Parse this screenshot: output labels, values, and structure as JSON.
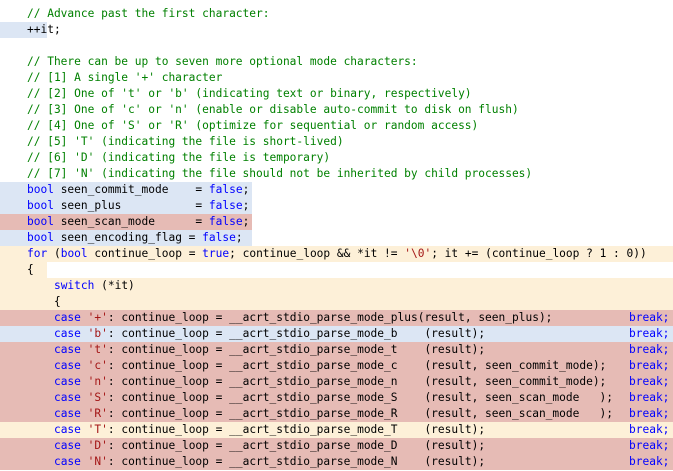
{
  "colors": {
    "default": "#000000",
    "comment": "#008000",
    "keyword": "#0000ff",
    "string": "#a31515",
    "highlight_blue": "#dce6f4",
    "highlight_red": "#e6bbb5",
    "highlight_yellow": "#fdf0d8"
  },
  "lines": [
    {
      "row": 0,
      "hl": null,
      "segs": [
        {
          "t": "// Advance past the first character:",
          "c": "comment"
        }
      ]
    },
    {
      "row": 1,
      "hl": "highlight_blue",
      "hlw": 47,
      "segs": [
        {
          "t": "++it;",
          "c": "default"
        }
      ]
    },
    {
      "row": 2,
      "hl": null,
      "segs": []
    },
    {
      "row": 3,
      "hl": null,
      "segs": [
        {
          "t": "// There can be up to seven more optional mode characters:",
          "c": "comment"
        }
      ]
    },
    {
      "row": 4,
      "hl": null,
      "segs": [
        {
          "t": "// [1] A single '+' character",
          "c": "comment"
        }
      ]
    },
    {
      "row": 5,
      "hl": null,
      "segs": [
        {
          "t": "// [2] One of 't' or 'b' (indicating text or binary, respectively)",
          "c": "comment"
        }
      ]
    },
    {
      "row": 6,
      "hl": null,
      "segs": [
        {
          "t": "// [3] One of 'c' or 'n' (enable or disable auto-commit to disk on flush)",
          "c": "comment"
        }
      ]
    },
    {
      "row": 7,
      "hl": null,
      "segs": [
        {
          "t": "// [4] One of 'S' or 'R' (optimize for sequential or random access)",
          "c": "comment"
        }
      ]
    },
    {
      "row": 8,
      "hl": null,
      "segs": [
        {
          "t": "// [5] 'T' (indicating the file is short-lived)",
          "c": "comment"
        }
      ]
    },
    {
      "row": 9,
      "hl": null,
      "segs": [
        {
          "t": "// [6] 'D' (indicating the file is temporary)",
          "c": "comment"
        }
      ]
    },
    {
      "row": 10,
      "hl": null,
      "segs": [
        {
          "t": "// [7] 'N' (indicating the file should not be inherited by child processes)",
          "c": "comment"
        }
      ]
    },
    {
      "row": 11,
      "hl": "highlight_blue",
      "hlw": 252,
      "segs": [
        {
          "t": "bool",
          "c": "keyword"
        },
        {
          "t": " seen_commit_mode    = ",
          "c": "default"
        },
        {
          "t": "false",
          "c": "keyword"
        },
        {
          "t": ";",
          "c": "default"
        }
      ]
    },
    {
      "row": 12,
      "hl": "highlight_blue",
      "hlw": 252,
      "segs": [
        {
          "t": "bool",
          "c": "keyword"
        },
        {
          "t": " seen_plus           = ",
          "c": "default"
        },
        {
          "t": "false",
          "c": "keyword"
        },
        {
          "t": ";",
          "c": "default"
        }
      ]
    },
    {
      "row": 13,
      "hl": "highlight_red",
      "hlw": 252,
      "segs": [
        {
          "t": "bool",
          "c": "keyword"
        },
        {
          "t": " seen_scan_mode      = ",
          "c": "default"
        },
        {
          "t": "false",
          "c": "keyword"
        },
        {
          "t": ";",
          "c": "default"
        }
      ]
    },
    {
      "row": 14,
      "hl": "highlight_blue",
      "hlw": 252,
      "segs": [
        {
          "t": "bool",
          "c": "keyword"
        },
        {
          "t": " seen_encoding_flag = ",
          "c": "default"
        },
        {
          "t": "false",
          "c": "keyword"
        },
        {
          "t": ";",
          "c": "default"
        }
      ]
    },
    {
      "row": 15,
      "hl": "highlight_yellow",
      "hlw": 673,
      "segs": [
        {
          "t": "for",
          "c": "keyword"
        },
        {
          "t": " (",
          "c": "default"
        },
        {
          "t": "bool",
          "c": "keyword"
        },
        {
          "t": " continue_loop = ",
          "c": "default"
        },
        {
          "t": "true",
          "c": "keyword"
        },
        {
          "t": "; continue_loop && *it != ",
          "c": "default"
        },
        {
          "t": "'\\0'",
          "c": "string"
        },
        {
          "t": "; it += (continue_loop ? 1 : 0))",
          "c": "default"
        }
      ]
    },
    {
      "row": 16,
      "hl": "highlight_yellow",
      "hlw": 47,
      "segs": [
        {
          "t": "{",
          "c": "default"
        }
      ]
    },
    {
      "row": 17,
      "hl": "highlight_yellow",
      "hlw": 673,
      "segs": [
        {
          "t": "    ",
          "c": "default"
        },
        {
          "t": "switch",
          "c": "keyword"
        },
        {
          "t": " (*it)",
          "c": "default"
        }
      ]
    },
    {
      "row": 18,
      "hl": "highlight_yellow",
      "hlw": 673,
      "segs": [
        {
          "t": "    {",
          "c": "default"
        }
      ]
    },
    {
      "row": 19,
      "hl": "highlight_red",
      "hlw": 673,
      "case": true,
      "segs": [
        {
          "t": "    ",
          "c": "default"
        },
        {
          "t": "case",
          "c": "keyword"
        },
        {
          "t": " ",
          "c": "default"
        },
        {
          "t": "'+'",
          "c": "string"
        },
        {
          "t": ": continue_loop = __acrt_stdio_parse_mode_plus(result, seen_plus);",
          "c": "default"
        }
      ]
    },
    {
      "row": 20,
      "hl": "highlight_blue",
      "hlw": 673,
      "case": true,
      "segs": [
        {
          "t": "    ",
          "c": "default"
        },
        {
          "t": "case",
          "c": "keyword"
        },
        {
          "t": " ",
          "c": "default"
        },
        {
          "t": "'b'",
          "c": "string"
        },
        {
          "t": ": continue_loop = __acrt_stdio_parse_mode_b    (result);",
          "c": "default"
        }
      ]
    },
    {
      "row": 21,
      "hl": "highlight_red",
      "hlw": 673,
      "case": true,
      "segs": [
        {
          "t": "    ",
          "c": "default"
        },
        {
          "t": "case",
          "c": "keyword"
        },
        {
          "t": " ",
          "c": "default"
        },
        {
          "t": "'t'",
          "c": "string"
        },
        {
          "t": ": continue_loop = __acrt_stdio_parse_mode_t    (result);",
          "c": "default"
        }
      ]
    },
    {
      "row": 22,
      "hl": "highlight_red",
      "hlw": 673,
      "case": true,
      "segs": [
        {
          "t": "    ",
          "c": "default"
        },
        {
          "t": "case",
          "c": "keyword"
        },
        {
          "t": " ",
          "c": "default"
        },
        {
          "t": "'c'",
          "c": "string"
        },
        {
          "t": ": continue_loop = __acrt_stdio_parse_mode_c    (result, seen_commit_mode);",
          "c": "default"
        }
      ]
    },
    {
      "row": 23,
      "hl": "highlight_red",
      "hlw": 673,
      "case": true,
      "segs": [
        {
          "t": "    ",
          "c": "default"
        },
        {
          "t": "case",
          "c": "keyword"
        },
        {
          "t": " ",
          "c": "default"
        },
        {
          "t": "'n'",
          "c": "string"
        },
        {
          "t": ": continue_loop = __acrt_stdio_parse_mode_n    (result, seen_commit_mode);",
          "c": "default"
        }
      ]
    },
    {
      "row": 24,
      "hl": "highlight_red",
      "hlw": 673,
      "case": true,
      "segs": [
        {
          "t": "    ",
          "c": "default"
        },
        {
          "t": "case",
          "c": "keyword"
        },
        {
          "t": " ",
          "c": "default"
        },
        {
          "t": "'S'",
          "c": "string"
        },
        {
          "t": ": continue_loop = __acrt_stdio_parse_mode_S    (result, seen_scan_mode   );",
          "c": "default"
        }
      ]
    },
    {
      "row": 25,
      "hl": "highlight_red",
      "hlw": 673,
      "case": true,
      "segs": [
        {
          "t": "    ",
          "c": "default"
        },
        {
          "t": "case",
          "c": "keyword"
        },
        {
          "t": " ",
          "c": "default"
        },
        {
          "t": "'R'",
          "c": "string"
        },
        {
          "t": ": continue_loop = __acrt_stdio_parse_mode_R    (result, seen_scan_mode   );",
          "c": "default"
        }
      ]
    },
    {
      "row": 26,
      "hl": "highlight_yellow",
      "hlw": 673,
      "case": true,
      "segs": [
        {
          "t": "    ",
          "c": "default"
        },
        {
          "t": "case",
          "c": "keyword"
        },
        {
          "t": " ",
          "c": "default"
        },
        {
          "t": "'T'",
          "c": "string"
        },
        {
          "t": ": continue_loop = __acrt_stdio_parse_mode_T    (result);",
          "c": "default"
        }
      ]
    },
    {
      "row": 27,
      "hl": "highlight_red",
      "hlw": 673,
      "case": true,
      "segs": [
        {
          "t": "    ",
          "c": "default"
        },
        {
          "t": "case",
          "c": "keyword"
        },
        {
          "t": " ",
          "c": "default"
        },
        {
          "t": "'D'",
          "c": "string"
        },
        {
          "t": ": continue_loop = __acrt_stdio_parse_mode_D    (result);",
          "c": "default"
        }
      ]
    },
    {
      "row": 28,
      "hl": "highlight_red",
      "hlw": 673,
      "case": true,
      "segs": [
        {
          "t": "    ",
          "c": "default"
        },
        {
          "t": "case",
          "c": "keyword"
        },
        {
          "t": " ",
          "c": "default"
        },
        {
          "t": "'N'",
          "c": "string"
        },
        {
          "t": ": continue_loop = __acrt_stdio_parse_mode_N    (result);",
          "c": "default"
        }
      ]
    }
  ],
  "break_text": "break;"
}
